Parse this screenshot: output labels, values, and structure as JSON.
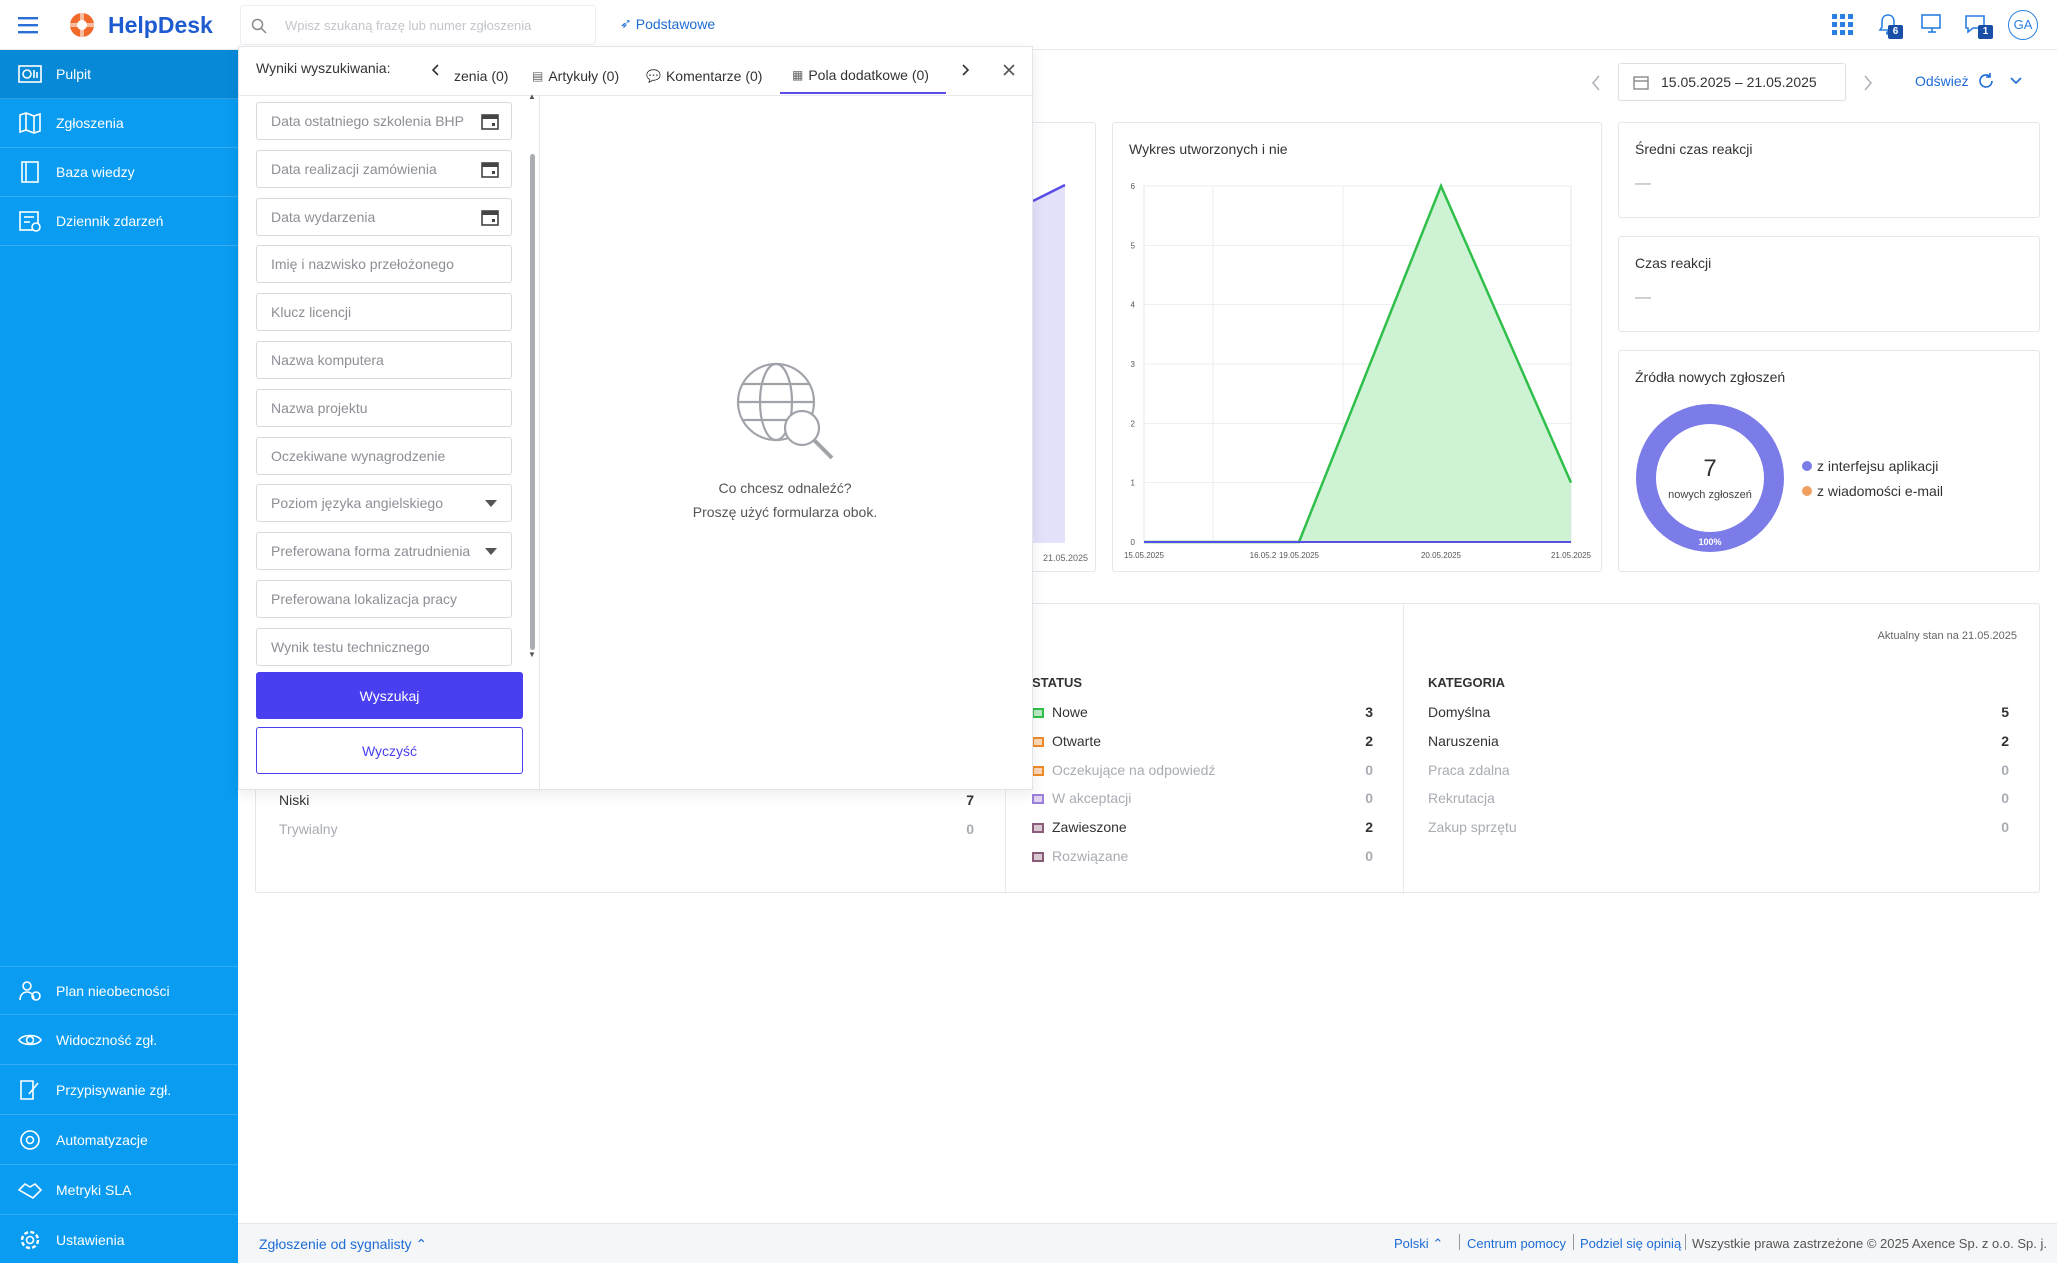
{
  "app": {
    "name": "HelpDesk"
  },
  "header": {
    "search_placeholder": "Wpisz szukaną frazę lub numer zgłoszenia",
    "mode": "Podstawowe",
    "notif_count": "6",
    "chat_count": "1",
    "avatar": "GA"
  },
  "sidebar": {
    "top": [
      {
        "label": "Pulpit"
      },
      {
        "label": "Zgłoszenia"
      },
      {
        "label": "Baza wiedzy"
      },
      {
        "label": "Dziennik zdarzeń"
      }
    ],
    "bottom": [
      {
        "label": "Plan nieobecności"
      },
      {
        "label": "Widoczność zgł."
      },
      {
        "label": "Przypisywanie zgł."
      },
      {
        "label": "Automatyzacje"
      },
      {
        "label": "Metryki SLA"
      },
      {
        "label": "Ustawienia"
      }
    ]
  },
  "toolbar": {
    "date_range": "15.05.2025 – 21.05.2025",
    "refresh": "Odśwież"
  },
  "search_panel": {
    "title": "Wyniki wyszukiwania:",
    "tabs": [
      {
        "label": "zenia (0)"
      },
      {
        "label": "Artykuły (0)"
      },
      {
        "label": "Komentarze (0)"
      },
      {
        "label": "Pola dodatkowe (0)"
      }
    ],
    "fields": [
      "Data ostatniego szkolenia BHP",
      "Data realizacji zamówienia",
      "Data wydarzenia",
      "Imię i nazwisko przełożonego",
      "Klucz licencji",
      "Nazwa komputera",
      "Nazwa projektu",
      "Oczekiwane wynagrodzenie",
      "Poziom języka angielskiego",
      "Preferowana forma zatrudnienia",
      "Preferowana lokalizacja pracy",
      "Wynik testu technicznego"
    ],
    "search_button": "Wyszukaj",
    "clear_button": "Wyczyść",
    "empty_line1": "Co chcesz odnaleźć?",
    "empty_line2": "Proszę użyć formularza obok."
  },
  "chart_card": {
    "title": "Wykres utworzonych i nie",
    "left_tick": "21.05.2025"
  },
  "chart_data": {
    "type": "area",
    "x": [
      "15.05.2025",
      "16.05.2",
      "19.05.2025",
      "20.05.2025",
      "21.05.2025"
    ],
    "series": [
      {
        "values": [
          0,
          0,
          0,
          6,
          1
        ],
        "color": "#2fbf4a"
      },
      {
        "values": [
          0,
          0,
          0,
          0,
          0
        ],
        "color": "#5a4de6"
      }
    ],
    "y_ticks": [
      "0",
      "1",
      "2",
      "3",
      "4",
      "5",
      "6"
    ],
    "ylim": [
      0,
      6
    ]
  },
  "kpi": {
    "avg_reaction": {
      "title": "Średni czas reakcji",
      "value": "—"
    },
    "reaction": {
      "title": "Czas reakcji",
      "value": "—"
    }
  },
  "sources": {
    "title": "Źródła nowych zgłoszeń",
    "total": "7",
    "total_label": "nowych zgłoszeń",
    "percent": "100%",
    "legend": [
      {
        "label": "z interfejsu aplikacji",
        "color": "#7b7ce8"
      },
      {
        "label": "z wiadomości e-mail",
        "color": "#f0a060"
      }
    ]
  },
  "stats": {
    "as_of": "Aktualny stan na 21.05.2025",
    "priority": [
      {
        "label": "Niski",
        "value": "7"
      },
      {
        "label": "Trywialny",
        "value": "0"
      }
    ],
    "status_title": "STATUS",
    "status": [
      {
        "label": "Nowe",
        "value": "3",
        "color": "#2fbf4a"
      },
      {
        "label": "Otwarte",
        "value": "2",
        "color": "#f08a2a"
      },
      {
        "label": "Oczekujące na odpowiedź",
        "value": "0",
        "color": "#f08a2a"
      },
      {
        "label": "W akceptacji",
        "value": "0",
        "color": "#9b7fd8"
      },
      {
        "label": "Zawieszone",
        "value": "2",
        "color": "#8a5c7a"
      },
      {
        "label": "Rozwiązane",
        "value": "0",
        "color": "#8a5c7a"
      }
    ],
    "category_title": "KATEGORIA",
    "category": [
      {
        "label": "Domyślna",
        "value": "5"
      },
      {
        "label": "Naruszenia",
        "value": "2"
      },
      {
        "label": "Praca zdalna",
        "value": "0"
      },
      {
        "label": "Rekrutacja",
        "value": "0"
      },
      {
        "label": "Zakup sprzętu",
        "value": "0"
      }
    ]
  },
  "footer": {
    "left": "Zgłoszenie od sygnalisty",
    "lang": "Polski",
    "help": "Centrum pomocy",
    "feedback": "Podziel się opinią",
    "copyright": "Wszystkie prawa zastrzeżone © 2025 Axence Sp. z o.o. Sp. j."
  }
}
